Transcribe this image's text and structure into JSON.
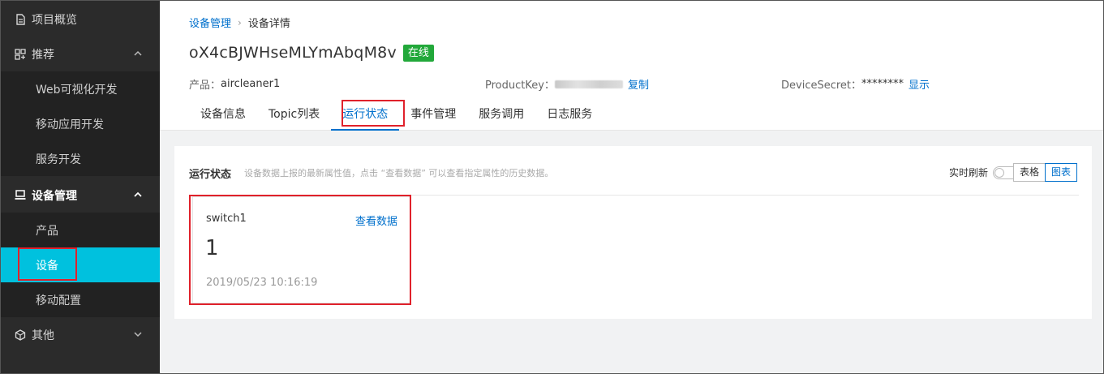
{
  "sidebar": {
    "items": [
      {
        "label": "项目概览",
        "icon": "document-icon"
      },
      {
        "label": "推荐",
        "icon": "grid-icon"
      },
      {
        "label": "Web可视化开发"
      },
      {
        "label": "移动应用开发"
      },
      {
        "label": "服务开发"
      },
      {
        "label": "设备管理",
        "icon": "monitor-icon"
      },
      {
        "label": "产品"
      },
      {
        "label": "设备"
      },
      {
        "label": "移动配置"
      },
      {
        "label": "其他",
        "icon": "cube-icon"
      }
    ]
  },
  "breadcrumb": {
    "parent": "设备管理",
    "separator": "›",
    "current": "设备详情"
  },
  "device": {
    "name": "oX4cBJWHseMLYmAbqM8v",
    "status": "在线"
  },
  "meta": {
    "product_label": "产品：",
    "product_value": "aircleaner1",
    "productkey_label": "ProductKey：",
    "copy_link": "复制",
    "secret_label": "DeviceSecret：",
    "secret_value": "********",
    "show_link": "显示"
  },
  "tabs": [
    "设备信息",
    "Topic列表",
    "运行状态",
    "事件管理",
    "服务调用",
    "日志服务"
  ],
  "active_tab": "运行状态",
  "panel": {
    "title": "运行状态",
    "description": "设备数据上报的最新属性值，点击 “查看数据” 可以查看指定属性的历史数据。",
    "refresh_label": "实时刷新",
    "view_table": "表格",
    "view_chart": "图表"
  },
  "property_card": {
    "name": "switch1",
    "link": "查看数据",
    "value": "1",
    "timestamp": "2019/05/23 10:16:19"
  },
  "colors": {
    "accent": "#00c1de",
    "link": "#0070cc",
    "online": "#22a83a",
    "highlight": "#e0212b",
    "sidebar_bg": "#2b2b2b"
  }
}
